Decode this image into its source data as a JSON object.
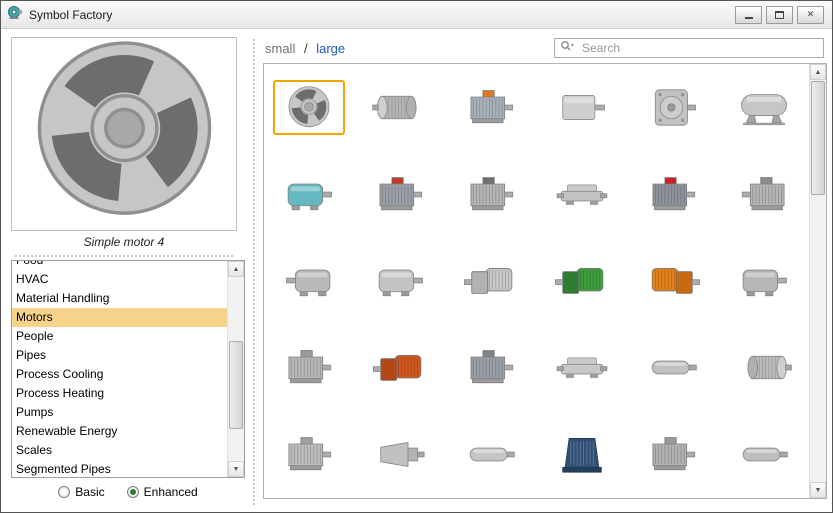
{
  "window": {
    "title": "Symbol Factory"
  },
  "icons": {
    "scroll_up": "▲",
    "scroll_down": "▼",
    "close_glyph": "✕"
  },
  "preview": {
    "caption": "Simple motor 4",
    "symbol": {
      "type": "round",
      "color": "#c6c6c6"
    }
  },
  "categories": {
    "items": [
      "Food",
      "HVAC",
      "Material Handling",
      "Motors",
      "People",
      "Pipes",
      "Process Cooling",
      "Process Heating",
      "Pumps",
      "Renewable Energy",
      "Scales",
      "Segmented Pipes"
    ],
    "selected": "Motors",
    "selected_bg": "#f5d38b"
  },
  "options": {
    "basic_label": "Basic",
    "enhanced_label": "Enhanced",
    "selected": "Enhanced"
  },
  "toolbar": {
    "small_label": "small",
    "separator": "/",
    "large_label": "large",
    "selected_size": "large",
    "search_placeholder": "Search"
  },
  "colors": {
    "selection_border": "#f0a500",
    "link_blue": "#1a5dba"
  },
  "grid": {
    "columns": 6,
    "rows": 5,
    "selected_index": 0,
    "items": [
      {
        "type": "round",
        "color": "#c6c6c6",
        "label": "Simple motor 4"
      },
      {
        "type": "ribbed",
        "color": "#b7b7b7"
      },
      {
        "type": "fin",
        "color": "#a9b2bc",
        "accent": "#e07820"
      },
      {
        "type": "box",
        "color": "#cfcfcf"
      },
      {
        "type": "face",
        "color": "#c2c2c2"
      },
      {
        "type": "tank",
        "color": "#c6c6c6"
      },
      {
        "type": "cyl",
        "color": "#63b8c1"
      },
      {
        "type": "fin",
        "color": "#9aa1a8",
        "accent": "#c23b22"
      },
      {
        "type": "fin",
        "color": "#b6b6b6",
        "accent": "#6e6e6e"
      },
      {
        "type": "flat",
        "color": "#c2c2c2"
      },
      {
        "type": "fin",
        "color": "#8d949b",
        "accent": "#cc2222"
      },
      {
        "type": "fin",
        "color": "#b6b6b6",
        "accent": "#8c8c8c",
        "flip": true
      },
      {
        "type": "cyl",
        "color": "#b9b9b9",
        "flip": true
      },
      {
        "type": "cyl",
        "color": "#c3c3c3"
      },
      {
        "type": "gear",
        "color": "#c9c9c9",
        "accent": "#b2b2b2"
      },
      {
        "type": "gear",
        "color": "#3d9e3d",
        "accent": "#2e7d32"
      },
      {
        "type": "gear",
        "color": "#e6801a",
        "accent": "#c96a10",
        "flip": true
      },
      {
        "type": "cyl",
        "color": "#b6b6b6"
      },
      {
        "type": "fin",
        "color": "#b9b9b9",
        "accent": "#9a9a9a"
      },
      {
        "type": "gear",
        "color": "#d4571e",
        "accent": "#b34715"
      },
      {
        "type": "fin",
        "color": "#9aa1a8",
        "accent": "#7d848c"
      },
      {
        "type": "flat",
        "color": "#c7c7c7"
      },
      {
        "type": "slim",
        "color": "#c1c1c1"
      },
      {
        "type": "ribbed",
        "color": "#bcbcbc",
        "flip": true
      },
      {
        "type": "fin",
        "color": "#bebebe",
        "accent": "#a2a2a2"
      },
      {
        "type": "cone",
        "color": "#c1c1c1"
      },
      {
        "type": "slim",
        "color": "#c5c5c5"
      },
      {
        "type": "bell",
        "color": "#2f4f74",
        "accent": "#243e5c"
      },
      {
        "type": "fin",
        "color": "#b3b3b3",
        "accent": "#9a9a9a"
      },
      {
        "type": "slim",
        "color": "#bebebe"
      }
    ]
  }
}
